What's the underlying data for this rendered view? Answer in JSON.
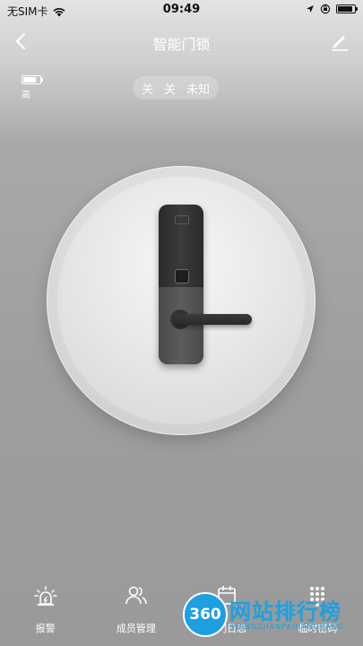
{
  "status_bar": {
    "carrier": "无SIM卡",
    "time": "09:49"
  },
  "nav": {
    "title": "智能门锁"
  },
  "battery": {
    "level_label": "高",
    "level_fraction": 0.8
  },
  "lock_status": {
    "items": [
      "关",
      "关",
      "未知"
    ]
  },
  "tabs": [
    {
      "label": "报警",
      "icon": "alarm-icon"
    },
    {
      "label": "成员管理",
      "icon": "members-icon"
    },
    {
      "label": "开门日志",
      "icon": "calendar-icon"
    },
    {
      "label": "临时密码",
      "icon": "keypad-icon"
    }
  ],
  "watermark": {
    "badge": "360",
    "text": "网站排行榜",
    "sub": "WANGZHANPAIHANGBANG"
  },
  "colors": {
    "watermark_blue": "#1ea0e0",
    "lock_body": "#2f2f2f"
  }
}
